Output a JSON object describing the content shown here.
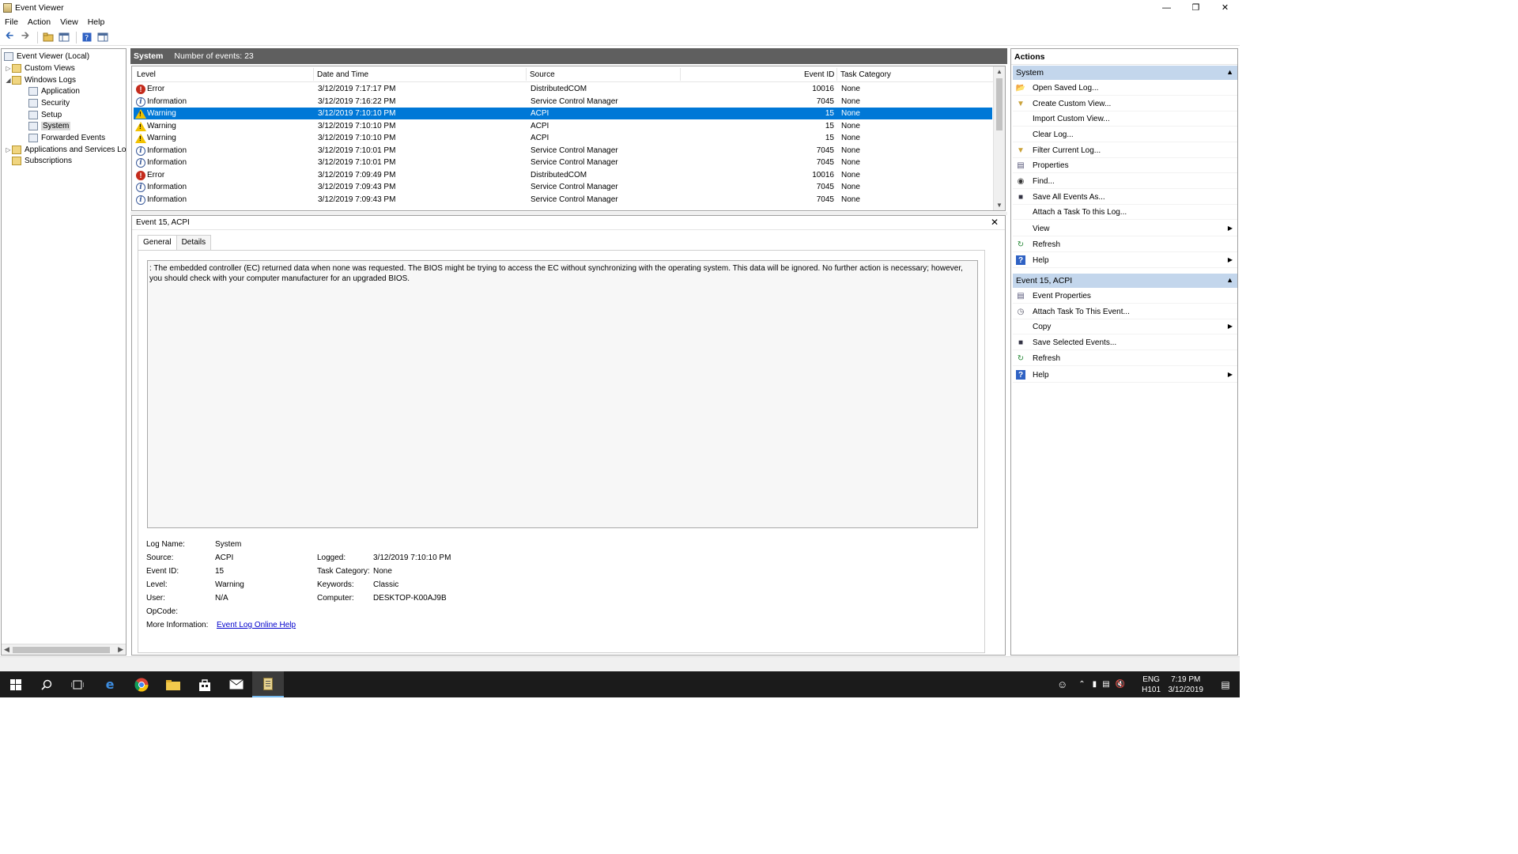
{
  "window": {
    "title": "Event Viewer"
  },
  "menu": [
    "File",
    "Action",
    "View",
    "Help"
  ],
  "tree": {
    "root": "Event Viewer (Local)",
    "custom_views": "Custom Views",
    "windows_logs": "Windows Logs",
    "application": "Application",
    "security": "Security",
    "setup": "Setup",
    "system": "System",
    "forwarded": "Forwarded Events",
    "app_services": "Applications and Services Lo",
    "subscriptions": "Subscriptions"
  },
  "center": {
    "log_name": "System",
    "count_text": "Number of events: 23"
  },
  "columns": {
    "level": "Level",
    "datetime": "Date and Time",
    "source": "Source",
    "event_id": "Event ID",
    "task_category": "Task Category"
  },
  "events": [
    {
      "level": "Error",
      "datetime": "3/12/2019 7:17:17 PM",
      "source": "DistributedCOM",
      "event_id": "10016",
      "task": "None"
    },
    {
      "level": "Information",
      "datetime": "3/12/2019 7:16:22 PM",
      "source": "Service Control Manager",
      "event_id": "7045",
      "task": "None"
    },
    {
      "level": "Warning",
      "datetime": "3/12/2019 7:10:10 PM",
      "source": "ACPI",
      "event_id": "15",
      "task": "None"
    },
    {
      "level": "Warning",
      "datetime": "3/12/2019 7:10:10 PM",
      "source": "ACPI",
      "event_id": "15",
      "task": "None"
    },
    {
      "level": "Warning",
      "datetime": "3/12/2019 7:10:10 PM",
      "source": "ACPI",
      "event_id": "15",
      "task": "None"
    },
    {
      "level": "Information",
      "datetime": "3/12/2019 7:10:01 PM",
      "source": "Service Control Manager",
      "event_id": "7045",
      "task": "None"
    },
    {
      "level": "Information",
      "datetime": "3/12/2019 7:10:01 PM",
      "source": "Service Control Manager",
      "event_id": "7045",
      "task": "None"
    },
    {
      "level": "Error",
      "datetime": "3/12/2019 7:09:49 PM",
      "source": "DistributedCOM",
      "event_id": "10016",
      "task": "None"
    },
    {
      "level": "Information",
      "datetime": "3/12/2019 7:09:43 PM",
      "source": "Service Control Manager",
      "event_id": "7045",
      "task": "None"
    },
    {
      "level": "Information",
      "datetime": "3/12/2019 7:09:43 PM",
      "source": "Service Control Manager",
      "event_id": "7045",
      "task": "None"
    }
  ],
  "detail": {
    "header": "Event 15, ACPI",
    "tab_general": "General",
    "tab_details": "Details",
    "description": ": The embedded controller (EC) returned data when none was requested. The BIOS might be trying to access the EC without synchronizing with the operating system. This data will be ignored. No further action is necessary; however, you should check with your computer manufacturer for an upgraded BIOS.",
    "labels": {
      "log_name": "Log Name:",
      "source": "Source:",
      "event_id": "Event ID:",
      "level": "Level:",
      "user": "User:",
      "opcode": "OpCode:",
      "more_info": "More Information:",
      "logged": "Logged:",
      "task_category": "Task Category:",
      "keywords": "Keywords:",
      "computer": "Computer:"
    },
    "values": {
      "log_name": "System",
      "source": "ACPI",
      "event_id": "15",
      "level": "Warning",
      "user": "N/A",
      "opcode": "",
      "more_info": "Event Log Online Help",
      "logged": "3/12/2019 7:10:10 PM",
      "task_category": "None",
      "keywords": "Classic",
      "computer": "DESKTOP-K00AJ9B"
    }
  },
  "actions": {
    "title": "Actions",
    "section1": "System",
    "items1": [
      "Open Saved Log...",
      "Create Custom View...",
      "Import Custom View...",
      "Clear Log...",
      "Filter Current Log...",
      "Properties",
      "Find...",
      "Save All Events As...",
      "Attach a Task To this Log...",
      "View",
      "Refresh",
      "Help"
    ],
    "section2": "Event 15, ACPI",
    "items2": [
      "Event Properties",
      "Attach Task To This Event...",
      "Copy",
      "Save Selected Events...",
      "Refresh",
      "Help"
    ]
  },
  "taskbar": {
    "lang1": "ENG",
    "lang2": "H101",
    "time": "7:19 PM",
    "date": "3/12/2019"
  },
  "colors": {
    "selection": "#0078d7",
    "section": "#c3d6ec",
    "header_bar": "#5f5f5f",
    "taskbar": "#1b1b1b"
  }
}
